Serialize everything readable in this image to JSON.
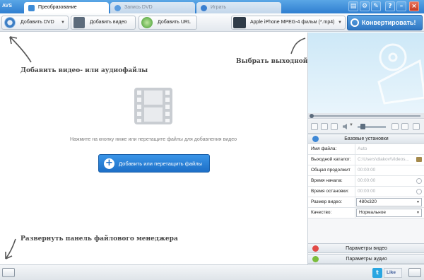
{
  "app": {
    "logo": "AVS"
  },
  "tabs": [
    {
      "label": "Преобразование",
      "active": true
    },
    {
      "label": "Запись DVD",
      "active": false
    },
    {
      "label": "Играть",
      "active": false
    }
  ],
  "toolbar": {
    "add_dvd": "Добавить DVD",
    "add_video": "Добавить видео",
    "add_url": "Добавить URL",
    "profile": "Apple iPhone MPEG-4 фильм (*.mp4)",
    "convert": "Конвертировать!"
  },
  "main": {
    "hint_add": "Добавить видео- или аудиофайлы",
    "hint_output": "Выбрать выходной профиль и конвертировать",
    "hint_file_manager": "Развернуть панель файлового менеджера",
    "drop_text": "Нажмите на кнопку ниже или перетащите файлы для добавления видео",
    "add_button": "Добавить или перетащить файлы"
  },
  "settings": {
    "basic_header": "Базовые установки",
    "rows": [
      {
        "label": "Имя файла:",
        "value": "Auto"
      },
      {
        "label": "Выходной каталог:",
        "value": "C:\\Users\\diakov\\Videos..."
      },
      {
        "label": "Общая продолжит",
        "value": "00:00:00"
      },
      {
        "label": "Время начала:",
        "value": "00:00:00"
      },
      {
        "label": "Время остановки:",
        "value": "00:00:00"
      },
      {
        "label": "Размер видео:",
        "value": "480x320"
      },
      {
        "label": "Качество:",
        "value": "Нормальное"
      }
    ],
    "video_params": "Параметры видео",
    "audio_params": "Параметры аудио"
  },
  "bottom": {
    "twitter": "t",
    "like": "Like"
  },
  "colors": {
    "accent": "#2f7fd0",
    "convert": "#2f77c3",
    "add_button": "#1d6fc7"
  }
}
